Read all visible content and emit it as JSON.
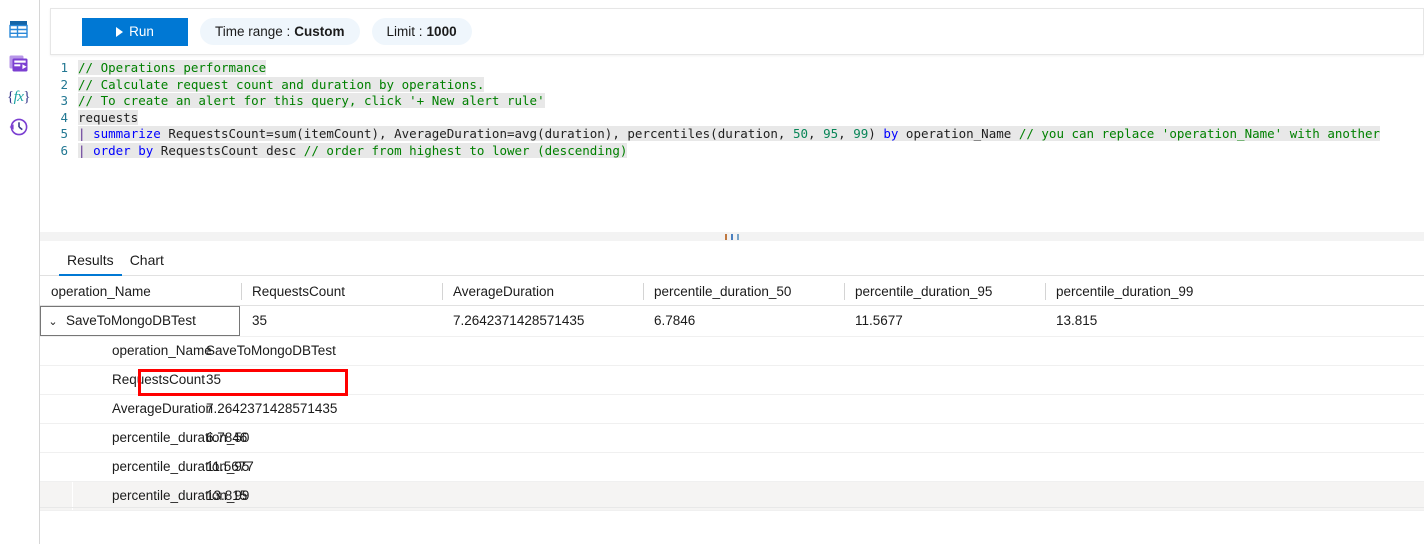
{
  "sidebar": {
    "items": [
      {
        "name": "tables-icon",
        "title": "Tables"
      },
      {
        "name": "queries-icon",
        "title": "Queries"
      },
      {
        "name": "functions-icon",
        "title": "Functions"
      },
      {
        "name": "query-history-icon",
        "title": "Query history"
      }
    ]
  },
  "toolbar": {
    "run_label": "Run",
    "time_range_label": "Time range :",
    "time_range_value": "Custom",
    "limit_label": "Limit :",
    "limit_value": "1000"
  },
  "editor": {
    "lines": [
      {
        "n": "1",
        "text": "// Operations performance"
      },
      {
        "n": "2",
        "text": "// Calculate request count and duration by operations."
      },
      {
        "n": "3",
        "text": "// To create an alert for this query, click '+ New alert rule'"
      },
      {
        "n": "4",
        "text": "requests"
      },
      {
        "n": "5",
        "text": "| summarize RequestsCount=sum(itemCount), AverageDuration=avg(duration), percentiles(duration, 50, 95, 99) by operation_Name // you can replace 'operation_Name' with another"
      },
      {
        "n": "6",
        "text": "| order by RequestsCount desc // order from highest to lower (descending)"
      }
    ],
    "line5_tail_comment": "// you can replace 'operation_Name' with another",
    "percentile_args": [
      "50",
      "95",
      "99"
    ]
  },
  "tabs": [
    {
      "label": "Results",
      "active": true
    },
    {
      "label": "Chart",
      "active": false
    }
  ],
  "table": {
    "columns": [
      "operation_Name",
      "RequestsCount",
      "AverageDuration",
      "percentile_duration_50",
      "percentile_duration_95",
      "percentile_duration_99"
    ],
    "rows": [
      {
        "expanded": true,
        "chevron": "⌄",
        "values": [
          "SaveToMongoDBTest",
          "35",
          "7.2642371428571435",
          "6.7846",
          "11.5677",
          "13.815"
        ]
      }
    ],
    "expanded_detail": [
      {
        "key": "operation_Name",
        "value": "SaveToMongoDBTest"
      },
      {
        "key": "RequestsCount",
        "value": "35"
      },
      {
        "key": "AverageDuration",
        "value": "7.2642371428571435"
      },
      {
        "key": "percentile_duration_50",
        "value": "6.7846"
      },
      {
        "key": "percentile_duration_95",
        "value": "11.5677"
      },
      {
        "key": "percentile_duration_99",
        "value": "13.815"
      }
    ],
    "highlight": {
      "target_key": "RequestsCount",
      "color": "#ff0000"
    }
  },
  "colors": {
    "accent": "#0078d4",
    "pill_bg": "#eff6fc",
    "highlight_red": "#ff0000",
    "comment_green": "#008000",
    "keyword_blue": "#0000ff",
    "number_green": "#098658",
    "operator_purple": "#5c2d91",
    "line_number": "#237893",
    "alt_row_bg": "#f5f4f3"
  }
}
